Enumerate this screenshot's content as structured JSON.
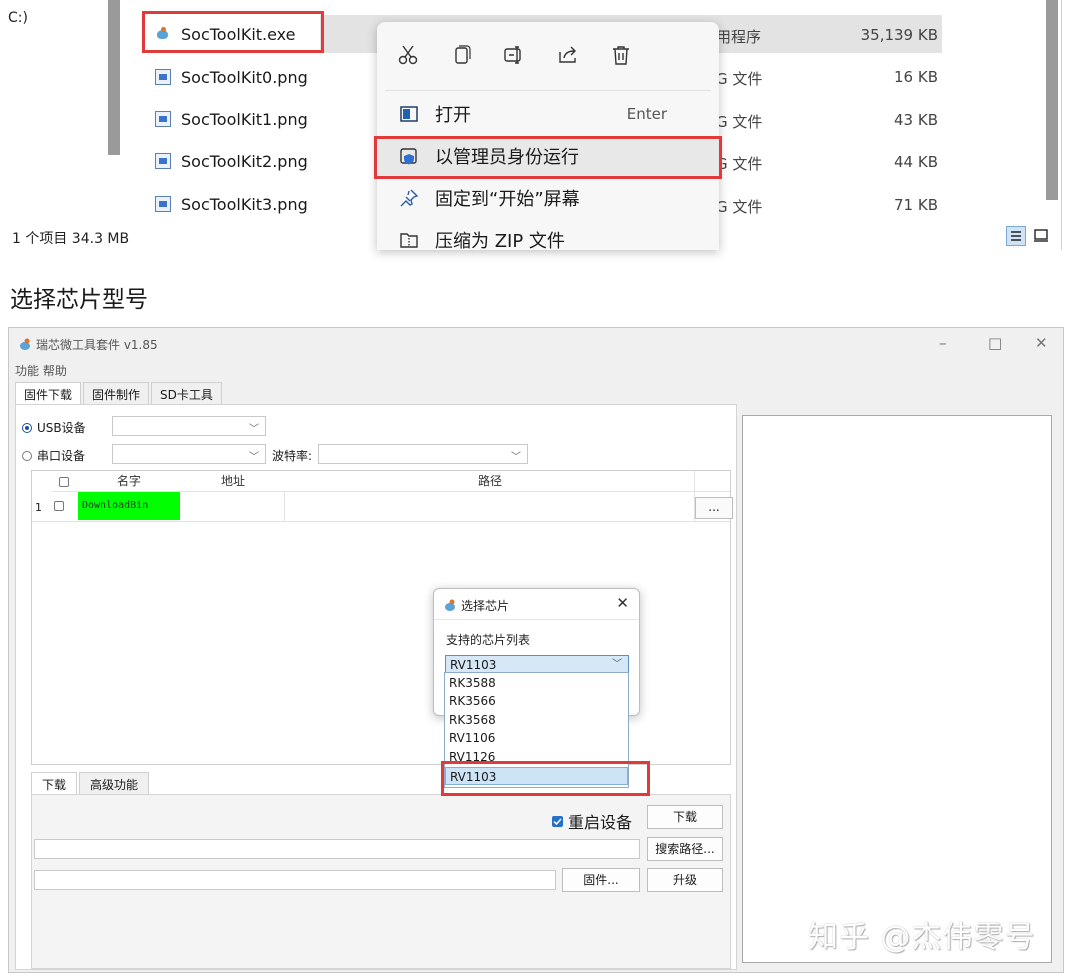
{
  "explorer": {
    "left_partial": "C:)",
    "files": [
      {
        "name": "SocToolKit.exe",
        "type": "用程序",
        "size": "35,139 KB",
        "icon": "exe-icon"
      },
      {
        "name": "SocToolKit0.png",
        "type": "G 文件",
        "size": "16 KB",
        "icon": "png-icon"
      },
      {
        "name": "SocToolKit1.png",
        "type": "G 文件",
        "size": "43 KB",
        "icon": "png-icon"
      },
      {
        "name": "SocToolKit2.png",
        "type": "G 文件",
        "size": "44 KB",
        "icon": "png-icon"
      },
      {
        "name": "SocToolKit3.png",
        "type": "G 文件",
        "size": "71 KB",
        "icon": "png-icon"
      }
    ],
    "status": "1 个项目  34.3 MB",
    "context_menu": {
      "toolbar_icons": [
        "cut-icon",
        "copy-icon",
        "rename-icon",
        "share-icon",
        "delete-icon"
      ],
      "items": [
        {
          "label": "打开",
          "shortcut": "Enter",
          "icon": "open-icon"
        },
        {
          "label": "以管理员身份运行",
          "shortcut": "",
          "icon": "shield-icon"
        },
        {
          "label": "固定到“开始”屏幕",
          "shortcut": "",
          "icon": "pin-icon"
        },
        {
          "label": "压缩为 ZIP 文件",
          "shortcut": "",
          "icon": "zip-icon"
        }
      ]
    }
  },
  "section_heading": "选择芯片型号",
  "tool": {
    "title": "瑞芯微工具套件 v1.85",
    "menu": "功能  帮助",
    "window_controls": {
      "minimize": "–",
      "maximize": "□",
      "close": "✕"
    },
    "tabs": [
      "固件下载",
      "固件制作",
      "SD卡工具"
    ],
    "usb_label": "USB设备",
    "serial_label": "串口设备",
    "baud_label": "波特率:",
    "grid_headers": {
      "name": "名字",
      "address": "地址",
      "path": "路径"
    },
    "grid_row": {
      "index": "1",
      "name": "DownloadBin",
      "address": "",
      "path": ""
    },
    "dots_label": "...",
    "lower_tabs": [
      "下载",
      "高级功能"
    ],
    "restart_label": "重启设备",
    "download_btn": "下载",
    "search_path_btn": "搜索路径...",
    "firmware_btn": "固件...",
    "upgrade_btn": "升级"
  },
  "dialog": {
    "title": "选择芯片",
    "close": "✕",
    "label": "支持的芯片列表",
    "selected": "RV1103",
    "options": [
      "RK3588",
      "RK3566",
      "RK3568",
      "RV1106",
      "RV1126",
      "RV1103"
    ]
  },
  "watermark": "知乎 @杰伟零号"
}
